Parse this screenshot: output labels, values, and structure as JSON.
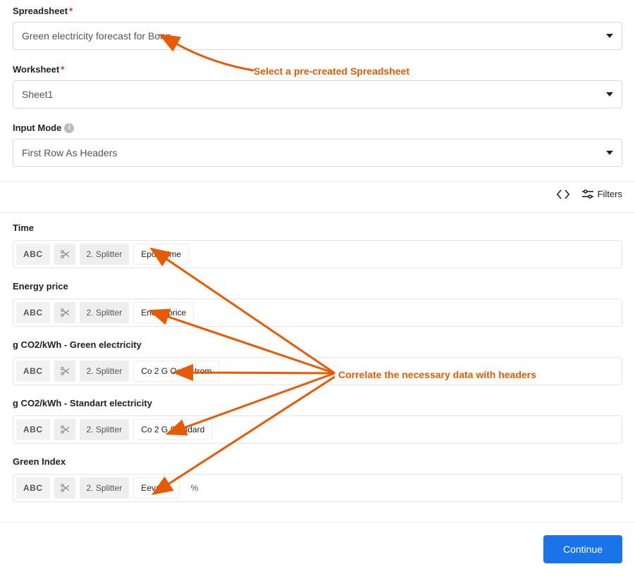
{
  "labels": {
    "spreadsheet": "Spreadsheet",
    "worksheet": "Worksheet",
    "inputMode": "Input Mode",
    "filters": "Filters"
  },
  "selects": {
    "spreadsheet": "Green electricity forecast for Bonn",
    "worksheet": "Sheet1",
    "inputMode": "First Row As Headers"
  },
  "chips": {
    "abc": "ABC",
    "splitter": "2. Splitter"
  },
  "fields": [
    {
      "label": "Time",
      "value": "Epochtime",
      "suffix": ""
    },
    {
      "label": "Energy price",
      "value": "Energyprice",
      "suffix": ""
    },
    {
      "label": "g CO2/kWh - Green electricity",
      "value": "Co 2 G Oekostrom",
      "suffix": ""
    },
    {
      "label": "g CO2/kWh - Standart electricity",
      "value": "Co 2 G Standard",
      "suffix": ""
    },
    {
      "label": "Green Index",
      "value": "Eevalue",
      "suffix": "%"
    }
  ],
  "annotations": {
    "top": "Select a pre-created Spreadsheet",
    "mid": "Correlate the necessary data with headers"
  },
  "buttons": {
    "continue": "Continue"
  }
}
